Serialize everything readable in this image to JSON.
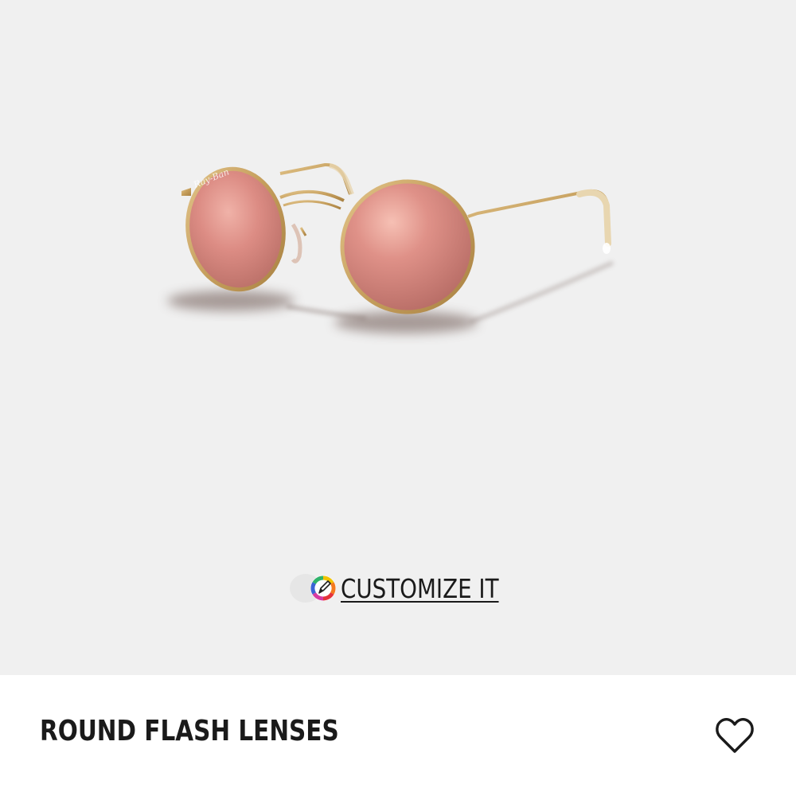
{
  "product": {
    "image_alt": "Round gold-frame sunglasses with pink flash lenses",
    "customize_label": "CUSTOMIZE IT",
    "title": "ROUND FLASH LENSES"
  },
  "icons": {
    "customize": "customize-pencil-icon",
    "wishlist": "heart-outline-icon"
  },
  "colors": {
    "hero_background": "#f0f0f0",
    "text": "#1a1a1a",
    "frame_gold": "#c9a465",
    "lens_pink": "#d9877f"
  }
}
